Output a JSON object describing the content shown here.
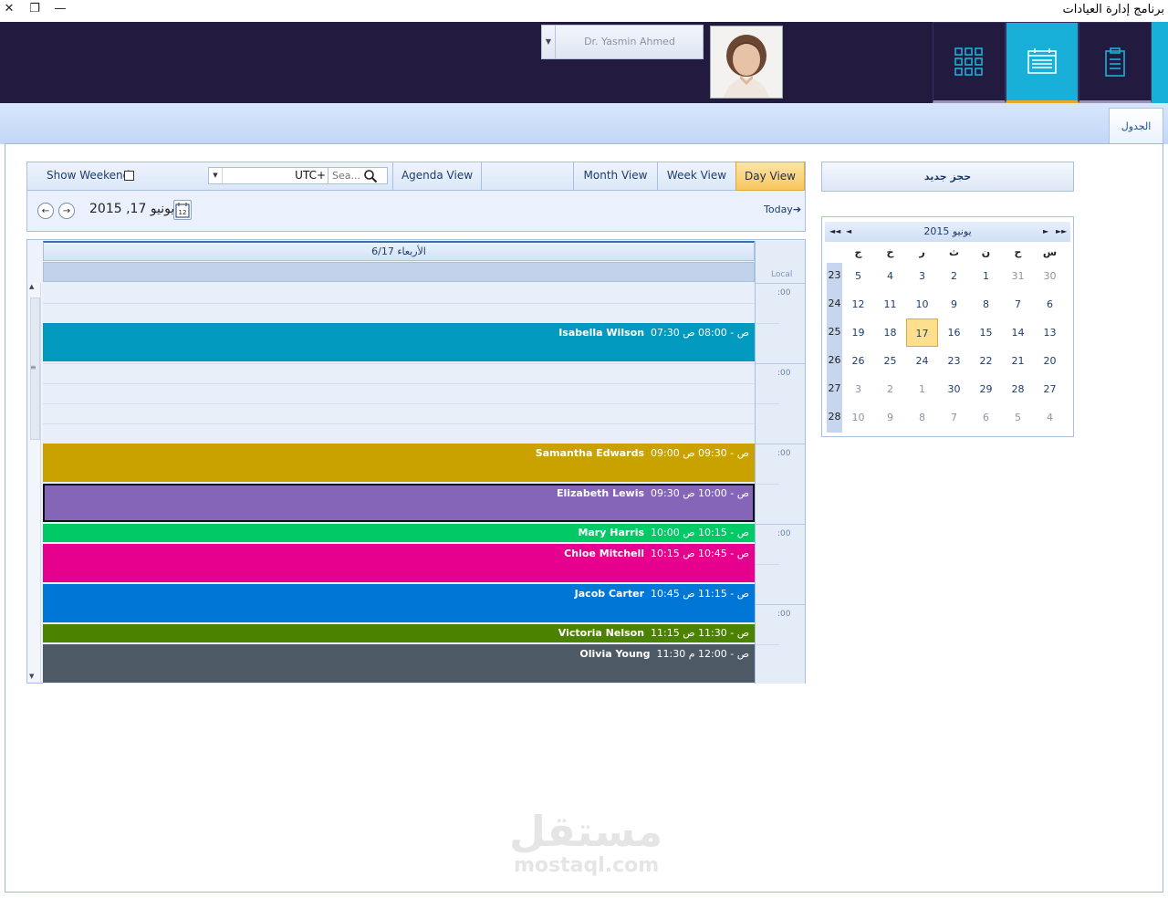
{
  "window": {
    "title": "برنامج إدارة العيادات",
    "close": "✕",
    "restore": "❐",
    "minimize": "—"
  },
  "header": {
    "user_name": "Dr. Yasmin Ahmed",
    "nav_tiles": [
      {
        "name": "dashboard",
        "icon": "grid-icon"
      },
      {
        "name": "schedule",
        "icon": "calendar-icon",
        "active": true
      },
      {
        "name": "clipboard",
        "icon": "clipboard-icon"
      }
    ],
    "colors": {
      "header_bg": "#231a3f",
      "accent": "#18b0d8",
      "active_underline": "#e7a72b"
    }
  },
  "tabs": [
    {
      "label": "الجدول",
      "active": true
    }
  ],
  "toolbar": {
    "show_weekend_label": "Show Weekend",
    "show_weekend_checked": false,
    "timezone_value": "UTC+",
    "search_placeholder": "Sea...",
    "views": [
      "Agenda View",
      "Month View",
      "Week View",
      "Day View"
    ],
    "active_view": "Day View"
  },
  "date_nav": {
    "current_date": "يونيو 17, 2015",
    "today_label": "Today",
    "prev": "←",
    "next": "→",
    "date_icon_day": "12"
  },
  "day_view": {
    "day_header": "الأربعاء 6/17",
    "tz_label": "Local",
    "time_labels": [
      ":00",
      ":00",
      ":00",
      ":00",
      ":00"
    ],
    "appointments": [
      {
        "name": "Isabella Wilson",
        "time": "07:30 ص - 08:00 ص",
        "color": "#039ac0"
      },
      {
        "name": "Samantha Edwards",
        "time": "09:00 ص - 09:30 ص",
        "color": "#c9a200"
      },
      {
        "name": "Elizabeth Lewis",
        "time": "09:30 ص - 10:00 ص",
        "color": "#8565b8",
        "selected": true
      },
      {
        "name": "Mary Harris",
        "time": "10:00 ص - 10:15 ص",
        "color": "#00c965"
      },
      {
        "name": "Chloe Mitchell",
        "time": "10:15 ص - 10:45 ص",
        "color": "#e6008e"
      },
      {
        "name": "Jacob Carter",
        "time": "10:45 ص - 11:15 ص",
        "color": "#0077d6"
      },
      {
        "name": "Victoria Nelson",
        "time": "11:15 ص - 11:30 ص",
        "color": "#4b8300"
      },
      {
        "name": "Olivia Young",
        "time": "11:30 ص - 12:00 م",
        "color": "#4d5964"
      }
    ]
  },
  "right_panel": {
    "new_booking_label": "حجز جديد",
    "mini_calendar": {
      "title": "يونيو 2015",
      "nav": {
        "prev_year": "◄◄",
        "prev": "◄",
        "next": "►",
        "next_year": "►►"
      },
      "dow": [
        "ج",
        "خ",
        "ر",
        "ث",
        "ن",
        "ح",
        "س"
      ],
      "weeks": [
        {
          "wk": "23",
          "days": [
            "5",
            "4",
            "3",
            "2",
            "1",
            "31",
            "30"
          ],
          "other": [
            false,
            false,
            false,
            false,
            false,
            true,
            true
          ]
        },
        {
          "wk": "24",
          "days": [
            "12",
            "11",
            "10",
            "9",
            "8",
            "7",
            "6"
          ],
          "other": [
            false,
            false,
            false,
            false,
            false,
            false,
            false
          ]
        },
        {
          "wk": "25",
          "days": [
            "19",
            "18",
            "17",
            "16",
            "15",
            "14",
            "13"
          ],
          "other": [
            false,
            false,
            false,
            false,
            false,
            false,
            false
          ]
        },
        {
          "wk": "26",
          "days": [
            "26",
            "25",
            "24",
            "23",
            "22",
            "21",
            "20"
          ],
          "other": [
            false,
            false,
            false,
            false,
            false,
            false,
            false
          ]
        },
        {
          "wk": "27",
          "days": [
            "3",
            "2",
            "1",
            "30",
            "29",
            "28",
            "27"
          ],
          "other": [
            true,
            true,
            true,
            false,
            false,
            false,
            false
          ]
        },
        {
          "wk": "28",
          "days": [
            "10",
            "9",
            "8",
            "7",
            "6",
            "5",
            "4"
          ],
          "other": [
            true,
            true,
            true,
            true,
            true,
            true,
            true
          ]
        }
      ],
      "today": "17"
    }
  },
  "watermark": {
    "arabic": "مستقل",
    "latin": "mostaql.com"
  }
}
